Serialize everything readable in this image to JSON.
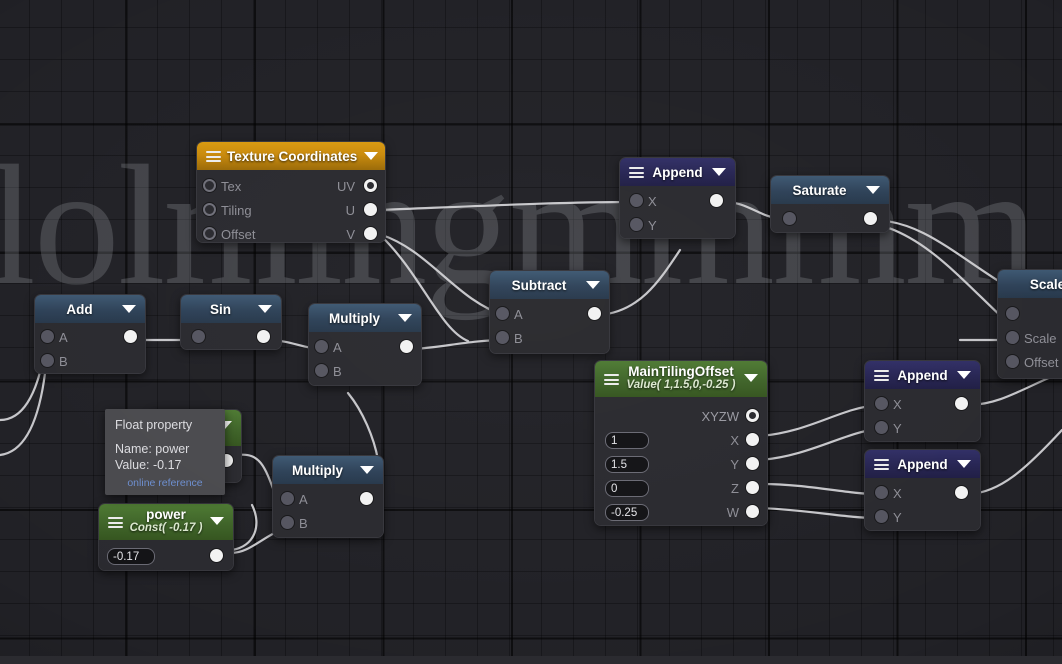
{
  "canvas": {
    "watermark": "lolmingmmmm",
    "grid": "node-graph-grid"
  },
  "nodes": [
    {
      "id": "texture-coordinates",
      "title": "Texture Coordinates",
      "color": "#c98a0c",
      "inputs": [
        "Tex",
        "Tiling",
        "Offset"
      ],
      "outputs": [
        "UV",
        "U",
        "V"
      ]
    },
    {
      "id": "add",
      "title": "Add",
      "color": "#2e4258",
      "inputs": [
        "A",
        "B"
      ],
      "outputs": [
        ""
      ]
    },
    {
      "id": "sin",
      "title": "Sin",
      "color": "#2e4258",
      "inputs": [
        ""
      ],
      "outputs": [
        ""
      ]
    },
    {
      "id": "multiply-top",
      "title": "Multiply",
      "color": "#2e4258",
      "inputs": [
        "A",
        "B"
      ],
      "outputs": [
        ""
      ]
    },
    {
      "id": "multiply-bottom",
      "title": "Multiply",
      "color": "#2e4258",
      "inputs": [
        "A",
        "B"
      ],
      "outputs": [
        ""
      ]
    },
    {
      "id": "subtract",
      "title": "Subtract",
      "color": "#2e4258",
      "inputs": [
        "A",
        "B"
      ],
      "outputs": [
        ""
      ]
    },
    {
      "id": "append-top",
      "title": "Append",
      "color": "#272553",
      "inputs": [
        "X",
        "Y"
      ],
      "outputs": [
        ""
      ]
    },
    {
      "id": "saturate",
      "title": "Saturate",
      "color": "#2e4258",
      "inputs": [
        ""
      ],
      "outputs": [
        ""
      ]
    },
    {
      "id": "scale",
      "title": "Scale",
      "color": "#2e4258",
      "inputs": [
        "Scale",
        "Offset"
      ],
      "outputs": [
        ""
      ]
    },
    {
      "id": "main-tiling-offset",
      "title": "MainTilingOffset",
      "subtitle": "Value( 1,1.5,0,-0.25 )",
      "color": "#3f6429",
      "outputs": [
        "XYZW",
        "X",
        "Y",
        "Z",
        "W"
      ],
      "values": [
        "1",
        "1.5",
        "0",
        "-0.25"
      ]
    },
    {
      "id": "append-mid",
      "title": "Append",
      "color": "#272553",
      "inputs": [
        "X",
        "Y"
      ],
      "outputs": [
        ""
      ]
    },
    {
      "id": "append-low",
      "title": "Append",
      "color": "#272553",
      "inputs": [
        "X",
        "Y"
      ],
      "outputs": [
        ""
      ]
    },
    {
      "id": "power",
      "title": "power",
      "subtitle": "Const( -0.17 )",
      "color": "#3f6429",
      "values": [
        "-0.17"
      ],
      "outputs": [
        ""
      ]
    }
  ],
  "texture_coordinates": {
    "title": "Texture Coordinates",
    "in_tex": "Tex",
    "in_tiling": "Tiling",
    "in_offset": "Offset",
    "out_uv": "UV",
    "out_u": "U",
    "out_v": "V"
  },
  "add_node": {
    "title": "Add",
    "in_a": "A",
    "in_b": "B"
  },
  "sin_node": {
    "title": "Sin"
  },
  "multiply_top": {
    "title": "Multiply",
    "in_a": "A",
    "in_b": "B"
  },
  "multiply_bottom": {
    "title": "Multiply",
    "in_a": "A",
    "in_b": "B"
  },
  "subtract_node": {
    "title": "Subtract",
    "in_a": "A",
    "in_b": "B"
  },
  "append_top": {
    "title": "Append",
    "in_x": "X",
    "in_y": "Y"
  },
  "saturate_node": {
    "title": "Saturate"
  },
  "scale_node": {
    "title": "Scale",
    "in_scale": "Scale",
    "in_offset": "Offset"
  },
  "main_tiling_offset": {
    "title": "MainTilingOffset",
    "subtitle": "Value( 1,1.5,0,-0.25 )",
    "out_xyzw": "XYZW",
    "out_x": "X",
    "out_y": "Y",
    "out_z": "Z",
    "out_w": "W",
    "val_x": "1",
    "val_y": "1.5",
    "val_z": "0",
    "val_w": "-0.25"
  },
  "append_mid": {
    "title": "Append",
    "in_x": "X",
    "in_y": "Y"
  },
  "append_low": {
    "title": "Append",
    "in_x": "X",
    "in_y": "Y"
  },
  "power_node": {
    "title": "power",
    "subtitle": "Const( -0.17 )",
    "value": "-0.17"
  },
  "tooltip": {
    "heading": "Float property",
    "name_line": "Name: power",
    "value_line": "Value: -0.17",
    "link": "online reference"
  }
}
